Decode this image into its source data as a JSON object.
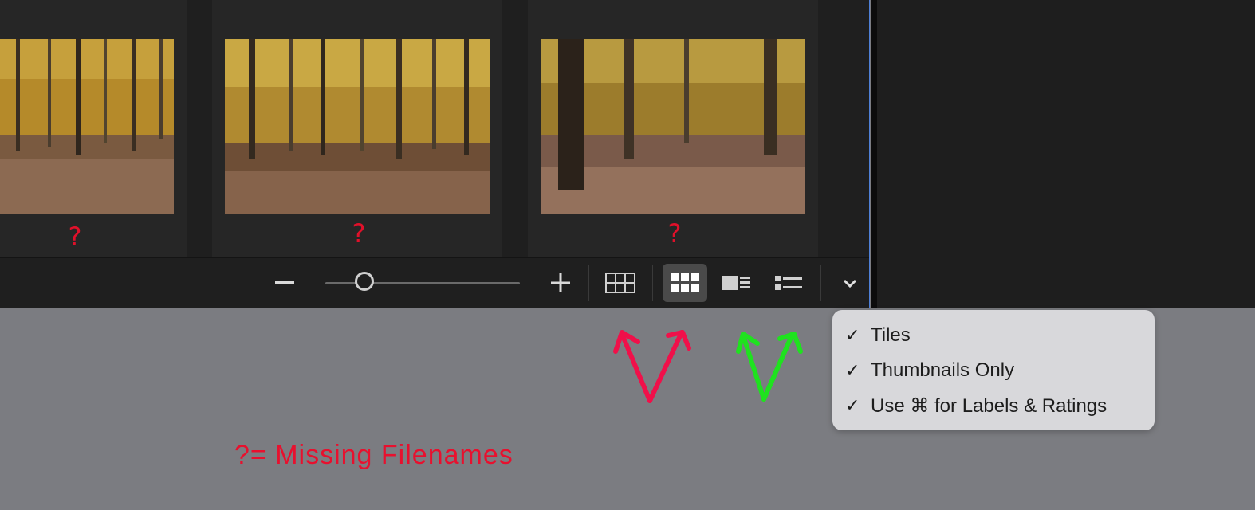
{
  "thumbnails": [
    {
      "filename_marker": "?"
    },
    {
      "filename_marker": "?"
    },
    {
      "filename_marker": "?"
    }
  ],
  "toolbar": {
    "zoom_out_icon": "minus-icon",
    "zoom_in_icon": "plus-icon",
    "zoom_level_fraction": 0.2,
    "views": [
      {
        "icon": "grid-outline-icon",
        "active": false
      },
      {
        "icon": "grid-filled-icon",
        "active": true
      },
      {
        "icon": "thumbnail-detail-icon",
        "active": false
      },
      {
        "icon": "list-icon",
        "active": false
      }
    ],
    "more_icon": "chevron-down-icon"
  },
  "menu": {
    "items": [
      {
        "label": "Tiles",
        "checked": true
      },
      {
        "label": "Thumbnails Only",
        "checked": true
      },
      {
        "label": "Use ⌘ for Labels & Ratings",
        "checked": true
      }
    ]
  },
  "annotation": {
    "legend": "?= Missing Filenames",
    "colors": {
      "red": "#e8102e",
      "green": "#1fe21f"
    }
  },
  "colors": {
    "accent_border": "#4d7fd6",
    "panel_bg": "#1f1f1f",
    "desktop_bg": "#7b7c81"
  }
}
